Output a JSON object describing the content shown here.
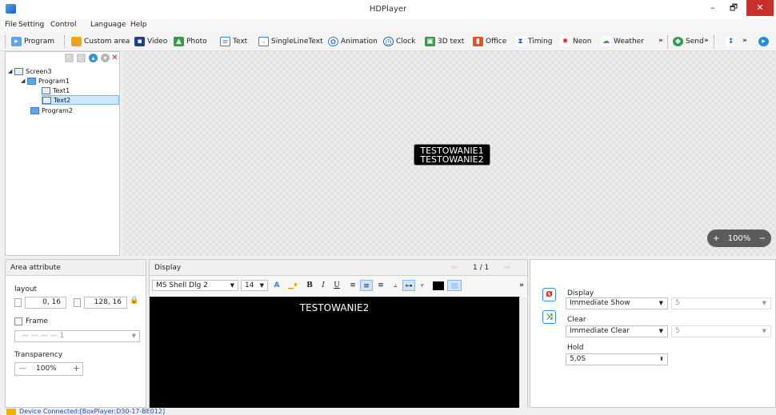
{
  "window": {
    "title": "HDPlayer",
    "min": "–",
    "max": "🗗",
    "close": "✕"
  },
  "menu": [
    "File",
    "Setting",
    "Control",
    "Language",
    "Help"
  ],
  "toolbar": {
    "items": [
      "Program",
      "Custom area",
      "Video",
      "Photo",
      "Text",
      "SingleLineText",
      "Animation",
      "Clock",
      "3D text",
      "Office",
      "Timing",
      "Neon",
      "Weather"
    ],
    "send": "Send",
    "more": "»"
  },
  "tree": {
    "screen": "Screen3",
    "program1": "Program1",
    "text1": "Text1",
    "text2": "Text2",
    "program2": "Program2"
  },
  "canvas": {
    "line1": "TESTOWANIE1",
    "line2": "TESTOWANIE2",
    "zoom": "100%"
  },
  "area_attribute": {
    "title": "Area attribute",
    "layout_label": "layout",
    "position": "0, 16",
    "size": "128, 16",
    "frame_label": "Frame",
    "frame_value": "1",
    "transparency_label": "Transparency",
    "transparency_value": "100%",
    "minus": "—",
    "plus": "+"
  },
  "display": {
    "title": "Display",
    "page": "1 / 1",
    "font": "MS Shell Dlg 2",
    "size": "14",
    "content": "TESTOWANIE2"
  },
  "effects": {
    "display_label": "Display",
    "display_mode": "Immediate Show",
    "display_speed": "5",
    "clear_label": "Clear",
    "clear_mode": "Immediate Clear",
    "clear_speed": "5",
    "hold_label": "Hold",
    "hold_value": "5,0S"
  },
  "status": "Device Connected:[BoxPlayer:D30-17-BE012]"
}
